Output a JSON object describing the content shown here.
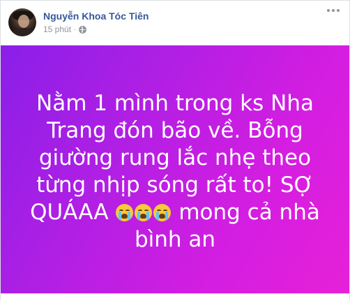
{
  "post": {
    "author_name": "Nguyễn Khoa Tóc Tiên",
    "timestamp": "15 phút",
    "separator": "·",
    "privacy_icon": "globe-icon",
    "more_icon": "more-options-icon",
    "avatar_icon": "profile-avatar"
  },
  "status": {
    "line1": "Nằm 1 mình trong ks Nha",
    "line2": "Trang đón bão về. Bỗng",
    "line3": "giường rung lắc nhẹ theo",
    "line4": "từng nhịp sóng rất to! SỢ",
    "line5_before": "QUÁAA",
    "line5_emoji_name": "loudly-crying-face",
    "line5_emoji_count": 3,
    "line5_after": "mong cả nhà",
    "line6": "bình an",
    "background_colors": [
      "#8a1fe8",
      "#e620d8"
    ]
  }
}
